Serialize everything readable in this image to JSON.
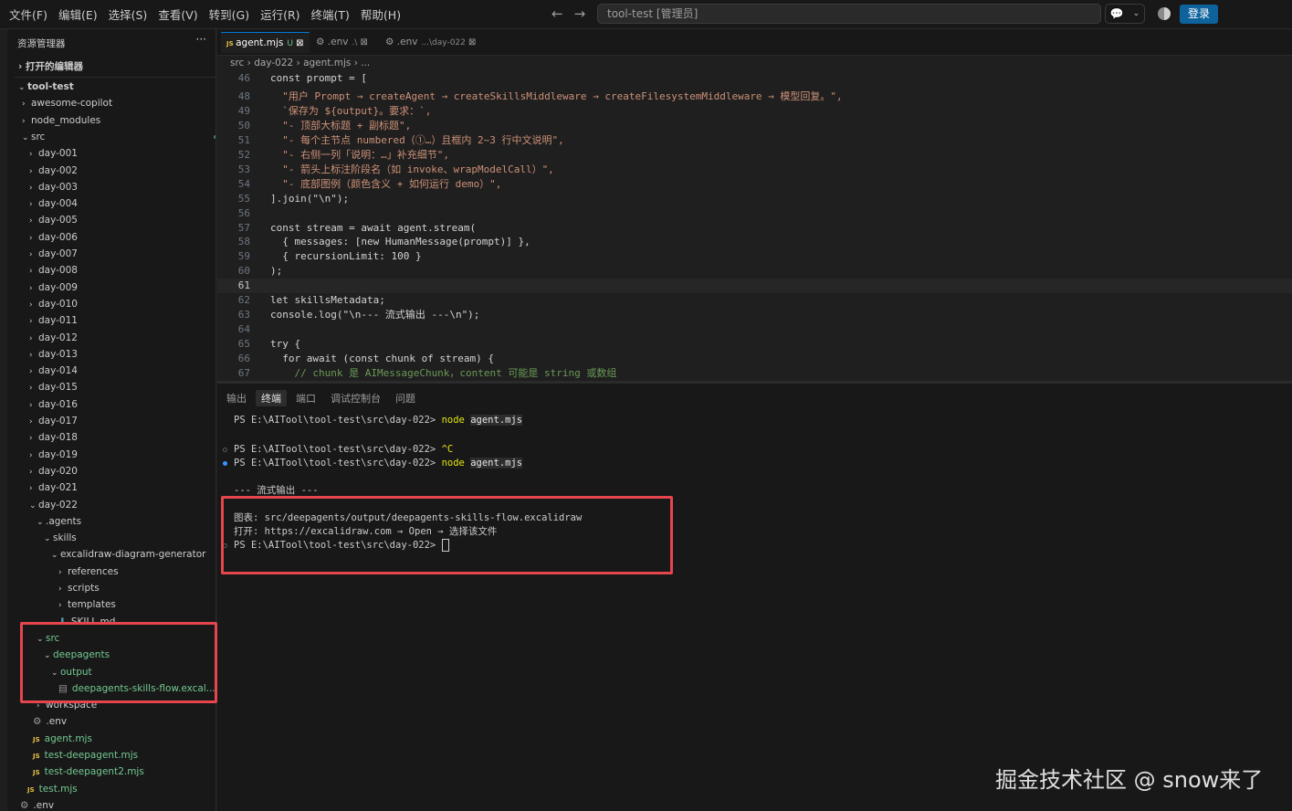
{
  "menu": [
    "文件(F)",
    "编辑(E)",
    "选择(S)",
    "查看(V)",
    "转到(G)",
    "运行(R)",
    "终端(T)",
    "帮助(H)"
  ],
  "command_center": "tool-test [管理员]",
  "login_label": "登录",
  "sidebar": {
    "title": "资源管理器",
    "more": "···",
    "open_editors": "打开的编辑器",
    "rows": [
      {
        "label": "tool-test",
        "chev": "v",
        "bold": true
      },
      {
        "label": "awesome-copilot",
        "chev": ">"
      },
      {
        "label": "node_modules",
        "chev": ">"
      },
      {
        "label": "src",
        "chev": "v",
        "dot": true
      },
      {
        "label": "day-001",
        "chev": ">",
        "dot": true
      },
      {
        "label": "day-002",
        "chev": ">",
        "dot": true
      },
      {
        "label": "day-003",
        "chev": ">",
        "dot": true
      },
      {
        "label": "day-004",
        "chev": ">",
        "dot": true
      },
      {
        "label": "day-005",
        "chev": ">",
        "dot": true
      },
      {
        "label": "day-006",
        "chev": ">",
        "dot": true
      },
      {
        "label": "day-007",
        "chev": ">",
        "dot": true
      },
      {
        "label": "day-008",
        "chev": ">",
        "dot": true
      },
      {
        "label": "day-009",
        "chev": ">",
        "dot": true
      },
      {
        "label": "day-010",
        "chev": ">",
        "dot": true
      },
      {
        "label": "day-011",
        "chev": ">",
        "dot": true
      },
      {
        "label": "day-012",
        "chev": ">",
        "dot": true
      },
      {
        "label": "day-013",
        "chev": ">",
        "dot": true
      },
      {
        "label": "day-014",
        "chev": ">",
        "dot": true
      },
      {
        "label": "day-015",
        "chev": ">",
        "dot": true
      },
      {
        "label": "day-016",
        "chev": ">",
        "dot": true
      },
      {
        "label": "day-017",
        "chev": ">",
        "dot": true
      },
      {
        "label": "day-018",
        "chev": ">",
        "dot": true
      },
      {
        "label": "day-019",
        "chev": ">",
        "dot": true
      },
      {
        "label": "day-020",
        "chev": ">",
        "dot": true
      },
      {
        "label": "day-021",
        "chev": ">",
        "dot": true
      },
      {
        "label": "day-022",
        "chev": "v",
        "dot": true
      },
      {
        "label": ".agents",
        "chev": "v"
      },
      {
        "label": "skills",
        "chev": "v"
      },
      {
        "label": "excalidraw-diagram-generator",
        "chev": "v"
      },
      {
        "label": "references",
        "chev": ">"
      },
      {
        "label": "scripts",
        "chev": ">"
      },
      {
        "label": "templates",
        "chev": ">"
      },
      {
        "label": "SKILL.md",
        "icon": "md"
      },
      {
        "label": "src",
        "chev": "v",
        "dot": true,
        "green": true
      },
      {
        "label": "deepagents",
        "chev": "v",
        "dot": true,
        "green": true
      },
      {
        "label": "output",
        "chev": "v",
        "dot": true,
        "green": true
      },
      {
        "label": "deepagents-skills-flow.excal...",
        "icon": "file",
        "badge": "U",
        "green": true
      },
      {
        "label": "workspace",
        "chev": ">",
        "dot": true
      },
      {
        "label": ".env",
        "icon": "gear"
      },
      {
        "label": "agent.mjs",
        "icon": "js",
        "badge": "U",
        "green": true
      },
      {
        "label": "test-deepagent.mjs",
        "icon": "js",
        "badge": "U",
        "green": true
      },
      {
        "label": "test-deepagent2.mjs",
        "icon": "js",
        "badge": "U",
        "green": true
      },
      {
        "label": "test.mjs",
        "icon": "js",
        "badge": "U",
        "green": true
      },
      {
        "label": ".env",
        "icon": "gear"
      }
    ]
  },
  "tabs": [
    {
      "label": "agent.mjs",
      "suffix": "U",
      "icon": "JS",
      "active": true
    },
    {
      "label": ".env",
      "suffix": ".\\",
      "icon": "gear"
    },
    {
      "label": ".env",
      "suffix": "...\\day-022",
      "icon": "gear"
    }
  ],
  "breadcrumb": [
    "src",
    "day-022",
    "agent.mjs",
    "..."
  ],
  "code_lines": [
    {
      "n": "46",
      "t": "const prompt = ["
    },
    {
      "n": "48",
      "t": "  \"用户 Prompt → createAgent → createSkillsMiddleware → createFilesystemMiddleware → 模型回复。\","
    },
    {
      "n": "49",
      "t": "  `保存为 ${output}。要求：`,"
    },
    {
      "n": "50",
      "t": "  \"- 顶部大标题 + 副标题\","
    },
    {
      "n": "51",
      "t": "  \"- 每个主节点 numbered（①…）且框内 2~3 行中文说明\","
    },
    {
      "n": "52",
      "t": "  \"- 右侧一列「说明：…」补充细节\","
    },
    {
      "n": "53",
      "t": "  \"- 箭头上标注阶段名（如 invoke、wrapModelCall）\","
    },
    {
      "n": "54",
      "t": "  \"- 底部图例（颜色含义 + 如何运行 demo）\","
    },
    {
      "n": "55",
      "t": "].join(\"\\n\");"
    },
    {
      "n": "56",
      "t": ""
    },
    {
      "n": "57",
      "t": "const stream = await agent.stream("
    },
    {
      "n": "58",
      "t": "  { messages: [new HumanMessage(prompt)] },"
    },
    {
      "n": "59",
      "t": "  { recursionLimit: 100 }"
    },
    {
      "n": "60",
      "t": ");"
    },
    {
      "n": "61",
      "t": "",
      "current": true
    },
    {
      "n": "62",
      "t": "let skillsMetadata;"
    },
    {
      "n": "63",
      "t": "console.log(\"\\n--- 流式输出 ---\\n\");"
    },
    {
      "n": "64",
      "t": ""
    },
    {
      "n": "65",
      "t": "try {"
    },
    {
      "n": "66",
      "t": "  for await (const chunk of stream) {"
    },
    {
      "n": "67",
      "t": "    // chunk 是 AIMessageChunk，content 可能是 string 或数组"
    }
  ],
  "panel_tabs": [
    "输出",
    "终端",
    "端口",
    "调试控制台",
    "问题"
  ],
  "terminal": {
    "prompt": "PS E:\\AITool\\tool-test\\src\\day-022>",
    "cmd_node": "node",
    "cmd_arg": "agent.mjs",
    "ctrl_c": "^C",
    "stream_header": "--- 流式输出 ---",
    "chart_line": "图表: src/deepagents/output/deepagents-skills-flow.excalidraw",
    "open_line": "打开: https://excalidraw.com → Open → 选择该文件"
  },
  "watermark": "掘金技术社区 @ snow来了"
}
